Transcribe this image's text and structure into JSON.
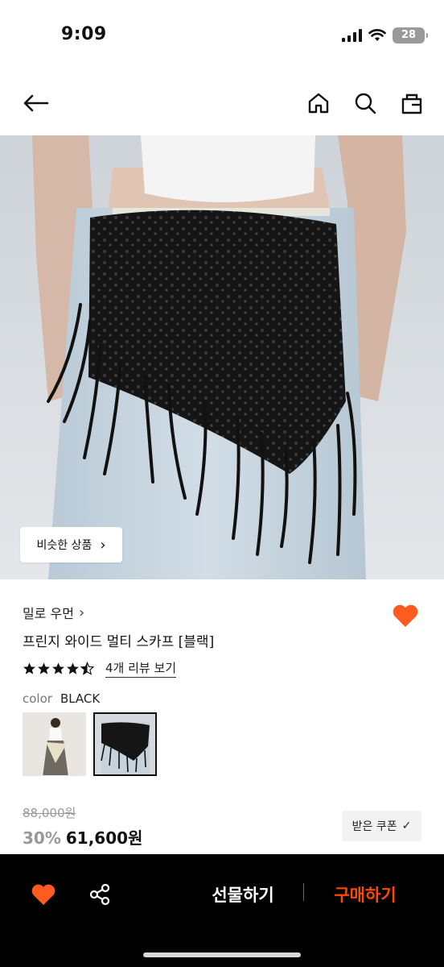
{
  "status_bar": {
    "time": "9:09",
    "battery": "28"
  },
  "nav": {
    "icons": [
      "back-arrow-icon",
      "home-icon",
      "search-icon",
      "shopping-bag-icon"
    ]
  },
  "hero": {
    "similar_label": "비슷한 상품",
    "similar_chevron": "›"
  },
  "product": {
    "brand": "밀로 우먼",
    "brand_chevron": "›",
    "name": "프린지 와이드 멀티 스카프 [블랙]",
    "rating": 4.5,
    "review_link": "4개 리뷰 보기",
    "color_label": "color",
    "color_value": "BLACK",
    "original_price": "88,000원",
    "discount": "30%",
    "sale_price": "61,600원",
    "coupon_label": "받은 쿠폰",
    "coupon_check": "✓",
    "wishlist_color": "#ff5a1f"
  },
  "bottom_bar": {
    "gift_label": "선물하기",
    "buy_label": "구매하기",
    "buy_color": "#ff4800"
  }
}
